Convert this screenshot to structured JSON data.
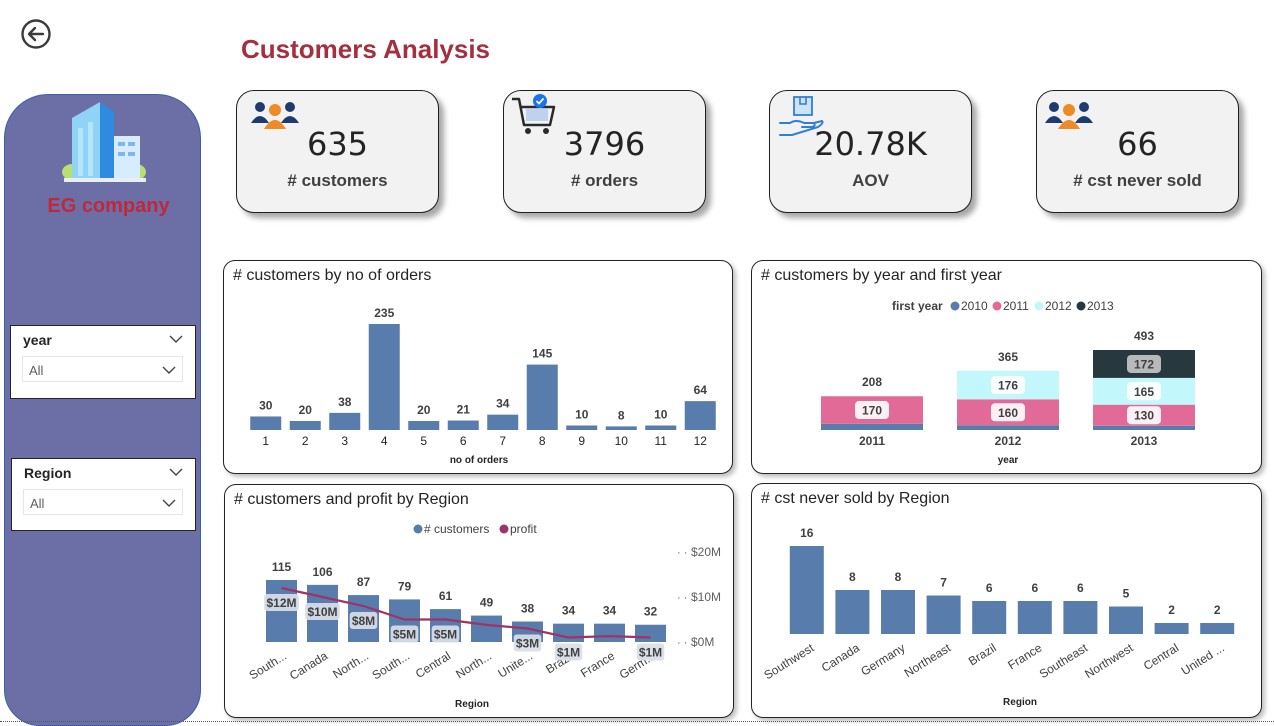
{
  "page": {
    "title": "Customers Analysis"
  },
  "brand": {
    "name": "EG company"
  },
  "icons": {
    "back": "back-arrow-icon",
    "logo": "building-icon"
  },
  "colors": {
    "bar": "#587cab",
    "title": "#a4303f",
    "sidebar": "#6b6fa6",
    "profit": "#9e3366"
  },
  "filters": {
    "year": {
      "label": "year",
      "value": "All"
    },
    "region": {
      "label": "Region",
      "value": "All"
    }
  },
  "kpis": [
    {
      "value": "635",
      "label": "# customers",
      "icon": "people-icon"
    },
    {
      "value": "3796",
      "label": "# orders",
      "icon": "cart-icon"
    },
    {
      "value": "20.78K",
      "label": "AOV",
      "icon": "hand-box-icon"
    },
    {
      "value": "66",
      "label": "# cst never sold",
      "icon": "people-icon"
    }
  ],
  "chart_data": [
    {
      "type": "bar",
      "title": "# customers by no of orders",
      "xlabel": "no of orders",
      "categories": [
        "1",
        "2",
        "3",
        "4",
        "5",
        "6",
        "7",
        "8",
        "9",
        "10",
        "11",
        "12"
      ],
      "values": [
        30,
        20,
        38,
        235,
        20,
        21,
        34,
        145,
        10,
        8,
        10,
        64
      ],
      "ylim": [
        0,
        235
      ],
      "grid": false
    },
    {
      "type": "bar",
      "title": "# customers by year and first year",
      "xlabel": "year",
      "legend_title": "first year",
      "legend_position": "top",
      "categories": [
        "2011",
        "2012",
        "2013"
      ],
      "series": [
        {
          "name": "2010",
          "color": "#587cab",
          "values": [
            38,
            29,
            26
          ]
        },
        {
          "name": "2011",
          "color": "#e16a96",
          "values": [
            170,
            160,
            130
          ]
        },
        {
          "name": "2012",
          "color": "#c2f7fb",
          "values": [
            0,
            176,
            165
          ]
        },
        {
          "name": "2013",
          "color": "#27393f",
          "values": [
            0,
            0,
            172
          ]
        }
      ],
      "totals": [
        208,
        365,
        493
      ],
      "stacked": true
    },
    {
      "type": "bar",
      "title": "# customers and profit by Region",
      "xlabel": "Region",
      "legend_position": "top",
      "categories": [
        "South...",
        "Canada",
        "North...",
        "South...",
        "Central",
        "North...",
        "Unite...",
        "Brazil",
        "France",
        "Germ..."
      ],
      "series": [
        {
          "name": "# customers",
          "color": "#587cab",
          "values": [
            115,
            106,
            87,
            79,
            61,
            49,
            38,
            34,
            34,
            32
          ]
        },
        {
          "name": "profit",
          "color": "#9e3366",
          "type": "line",
          "values": [
            12,
            10,
            8,
            5,
            5,
            3.8,
            3,
            1,
            1.3,
            1
          ]
        }
      ],
      "profit_labels": [
        "$12M",
        "$10M",
        "$8M",
        "$5M",
        "$5M",
        "$3M",
        "$1M",
        "$1M"
      ],
      "profit_label_index": [
        0,
        1,
        2,
        3,
        4,
        6,
        7,
        9
      ],
      "y2_ticks": [
        "$20M",
        "$10M",
        "$0M"
      ],
      "y2lim": [
        0,
        20
      ]
    },
    {
      "type": "bar",
      "title": "# cst never sold by Region",
      "xlabel": "Region",
      "categories": [
        "Southwest",
        "Canada",
        "Germany",
        "Northeast",
        "Brazil",
        "France",
        "Southeast",
        "Northwest",
        "Central",
        "United ..."
      ],
      "values": [
        16,
        8,
        8,
        7,
        6,
        6,
        6,
        5,
        2,
        2
      ],
      "ylim": [
        0,
        16
      ]
    }
  ]
}
